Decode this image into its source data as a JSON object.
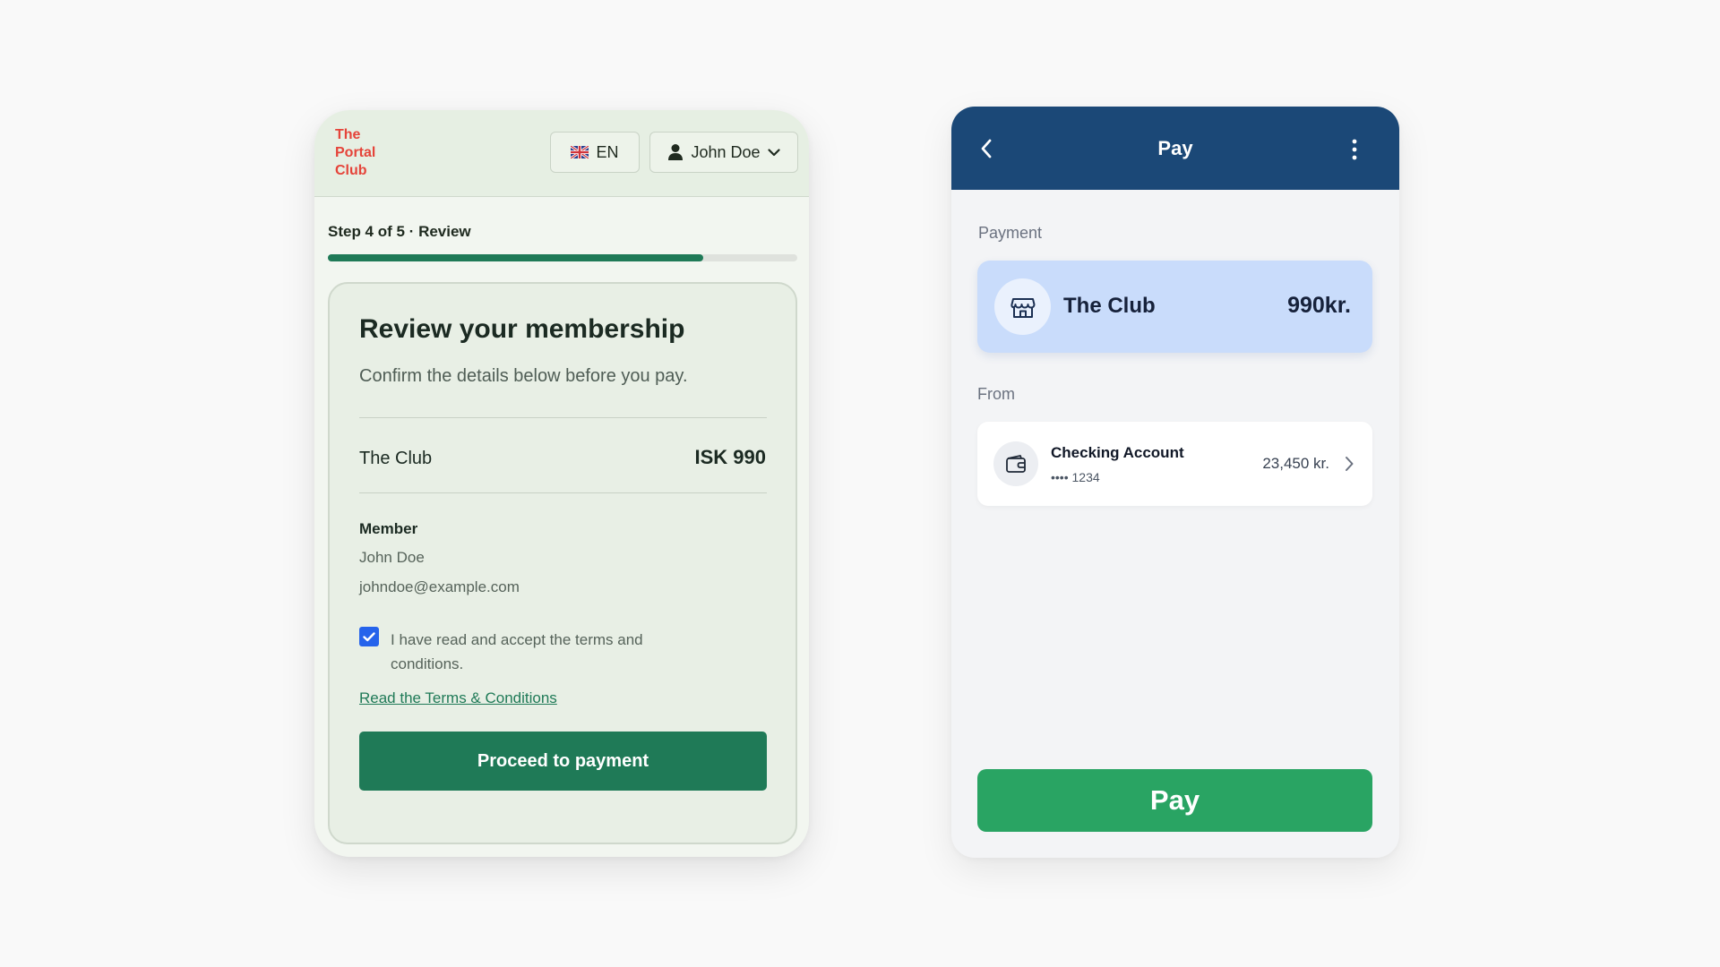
{
  "left_app": {
    "brand": {
      "line1": "The",
      "line2": "Portal",
      "line3": "Club",
      "color": "#e5443a"
    },
    "header": {
      "language": "EN",
      "flag_icon": "uk-flag-icon",
      "user_icon": "person-icon",
      "user_name": "John Doe",
      "dropdown_icon": "chevron-down-icon"
    },
    "progress": {
      "label": "Step 4 of 5 · Review",
      "fraction": 0.8,
      "color": "#1f7a57"
    },
    "review": {
      "title": "Review your membership",
      "subtitle": "Confirm the details below before you pay.",
      "item_name": "The Club",
      "item_price": "ISK 990",
      "member_heading": "Member",
      "member_name": "John Doe",
      "member_email": "johndoe@example.com",
      "terms_checked": true,
      "terms_text": "I have read and accept the terms and conditions.",
      "terms_link": "Read the Terms & Conditions",
      "proceed_label": "Proceed to payment"
    }
  },
  "right_app": {
    "header": {
      "title": "Pay",
      "back_icon": "chevron-left-icon",
      "menu_icon": "vertical-dots-icon",
      "color": "#1b4877"
    },
    "payment": {
      "section_label": "Payment",
      "merchant_icon": "store-icon",
      "merchant_name": "The Club",
      "amount": "990kr."
    },
    "from": {
      "section_label": "From",
      "wallet_icon": "wallet-icon",
      "account_name": "Checking Account",
      "account_number": "•••• 1234",
      "balance": "23,450 kr.",
      "chevron_icon": "chevron-right-icon"
    },
    "pay_button": {
      "label": "Pay",
      "color": "#29a463"
    }
  }
}
